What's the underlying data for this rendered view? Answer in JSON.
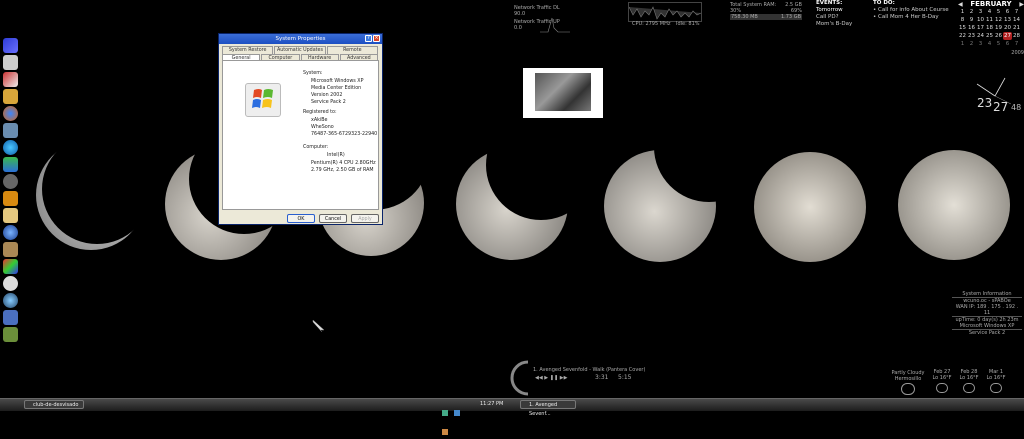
{
  "dialog": {
    "title": "System Properties",
    "tabs_top": [
      "System Restore",
      "Automatic Updates",
      "Remote"
    ],
    "tabs_bottom": [
      "General",
      "Computer Name",
      "Hardware",
      "Advanced"
    ],
    "system_label": "System:",
    "system_lines": [
      "Microsoft Windows XP",
      "Media Center Edition",
      "Version 2002",
      "Service Pack 2"
    ],
    "registered_label": "Registered to:",
    "registered_lines": [
      "xAkiBe",
      "WheSono",
      "76487-365-6729323-22940"
    ],
    "computer_label": "Computer:",
    "computer_lines": [
      "Intel(R)",
      "Pentium(R) 4 CPU 2.80GHz",
      "2.79 GHz, 2.50 GB of RAM"
    ],
    "buttons": {
      "ok": "OK",
      "cancel": "Cancel",
      "apply": "Apply"
    }
  },
  "network": {
    "dl_label": "Network Traffic DL",
    "dl_value": "90.0",
    "ul_label": "Network Traffic UP",
    "ul_value": "0.0"
  },
  "cpu": {
    "label": "CPU: 2795 MHz",
    "idle": "Idle: 81%"
  },
  "ram": {
    "title": "Total System RAM:",
    "total": "2.5 GB",
    "pct1": "30%",
    "pct2": "69%",
    "used": "758.30 MB",
    "free": "1.73 GB"
  },
  "events": {
    "title": "EVENTS:",
    "items": [
      "Tomorrow",
      "Call PD?",
      "Mom's B-Day"
    ]
  },
  "todo": {
    "title": "TO DO:",
    "items": [
      "Call for info About Ceurse",
      "Call Mom 4 Her B-Day"
    ]
  },
  "calendar": {
    "month": "FEBRUARY",
    "rows": [
      [
        "1",
        "2",
        "3",
        "4",
        "5",
        "6",
        "7"
      ],
      [
        "8",
        "9",
        "10",
        "11",
        "12",
        "13",
        "14"
      ],
      [
        "15",
        "16",
        "17",
        "18",
        "19",
        "20",
        "21"
      ],
      [
        "22",
        "23",
        "24",
        "25",
        "26",
        "27",
        "28"
      ],
      [
        "1",
        "2",
        "3",
        "4",
        "5",
        "6",
        "7"
      ]
    ],
    "year": "2009"
  },
  "clock": {
    "hour": "23",
    "minute": "27",
    "second": "48"
  },
  "sysinfo": {
    "title": "System Information",
    "lines": [
      "wcuno.oc - sPABOe",
      "WAN IP: 189 . 175 . 192 . 11",
      "upTime: 0 day(s) 2h 23m",
      "Microsoft Windows XP",
      "Service Pack 2"
    ]
  },
  "music": {
    "track": "1. Avenged Sevenfold - Walk (Pantera Cover)",
    "elapsed": "3:31",
    "total": "5:15"
  },
  "weather": {
    "current": {
      "label": "Partly Cloudy",
      "temp": "Hermosillo"
    },
    "days": [
      {
        "day": "Feb 27",
        "temp": "Lo 16°F"
      },
      {
        "day": "Feb 28",
        "temp": "Lo 16°F"
      },
      {
        "day": "Mar 1",
        "temp": "Lo 16°F"
      }
    ]
  },
  "taskbar": {
    "task1": "club-de-desvisado",
    "time": "11:27 PM",
    "task2": "1. Avenged Sevenf..."
  },
  "colors": {
    "moon": "#b8b4ac",
    "dialog_bg": "#ece9d8",
    "titlebar": "#2a5fcf",
    "today": "#b02020"
  }
}
